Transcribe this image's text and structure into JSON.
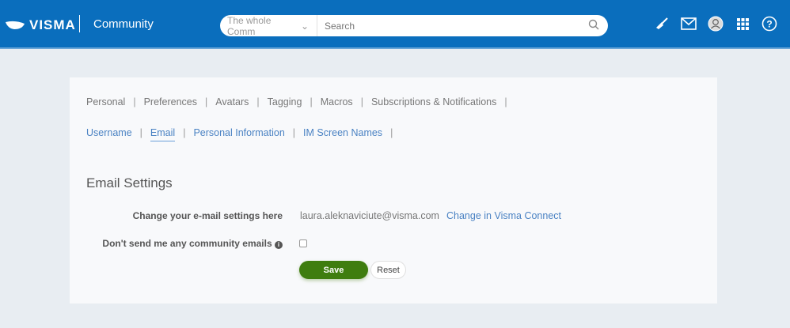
{
  "header": {
    "logo": "VISMA",
    "title": "Community",
    "search_scope": "The whole Comm",
    "search_placeholder": "Search"
  },
  "nav_primary": [
    "Personal",
    "Preferences",
    "Avatars",
    "Tagging",
    "Macros",
    "Subscriptions & Notifications"
  ],
  "nav_secondary": [
    "Username",
    "Email",
    "Personal Information",
    "IM Screen Names"
  ],
  "section": {
    "title": "Email Settings",
    "change_label": "Change your e-mail settings here",
    "email": "laura.aleknaviciute@visma.com",
    "change_link": "Change in Visma Connect",
    "optout_label": "Don't send me any community emails",
    "optout_checked": false,
    "save": "Save",
    "reset": "Reset"
  },
  "colors": {
    "header": "#0a6ebd",
    "save": "#3f7d0f",
    "link": "#4a82c3"
  }
}
